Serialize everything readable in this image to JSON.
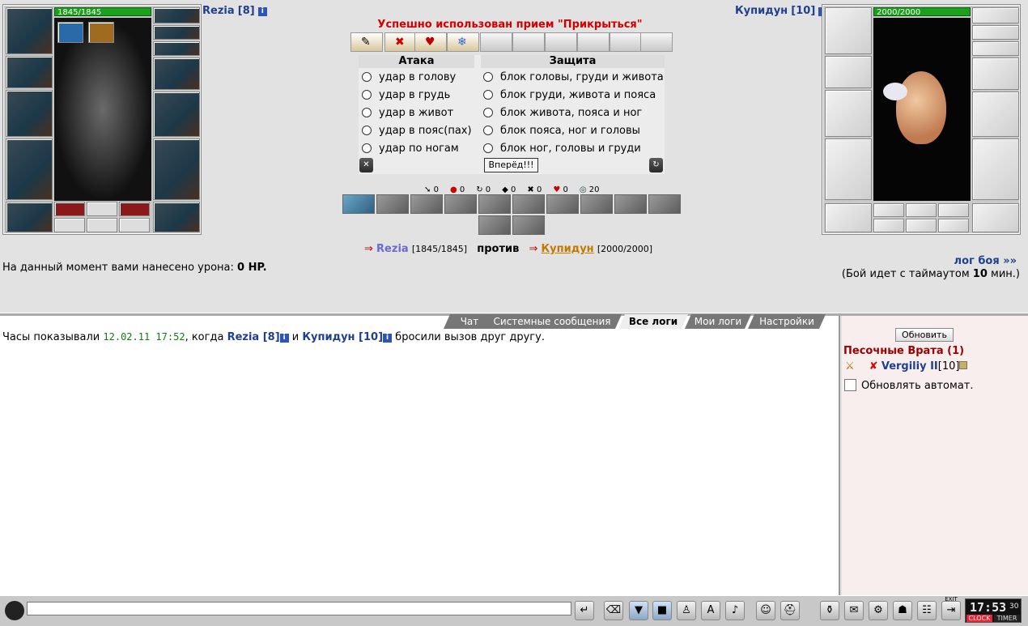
{
  "player": {
    "name": "Rezia",
    "level": "[8]",
    "hp": "1845/1845",
    "hp_fraction": 1.0
  },
  "opponent": {
    "name": "Купидун",
    "level": "[10]",
    "hp": "2000/2000",
    "hp_fraction": 1.0
  },
  "status_message": "Успешно использован прием \"Прикрыться\"",
  "attack": {
    "title": "Атака",
    "options": [
      "удар в голову",
      "удар в грудь",
      "удар в живот",
      "удар в пояс(пах)",
      "удар по ногам"
    ]
  },
  "defense": {
    "title": "Защита",
    "options": [
      "блок головы, груди и живота",
      "блок груди, живота и пояса",
      "блок живота, пояса и ног",
      "блок пояса, ног и головы",
      "блок ног, головы и груди"
    ]
  },
  "forward_button": "Вперёд!!!",
  "stats": [
    "0",
    "0",
    "0",
    "0",
    "0",
    "0",
    "20"
  ],
  "versus": {
    "p1": "Rezia",
    "p1_hp": "[1845/1845]",
    "vs": "против",
    "p2": "Купидун",
    "p2_hp": "[2000/2000]"
  },
  "damage": {
    "prefix": "На данный момент вами нанесено урона:",
    "value": "0 HP."
  },
  "battle_log_link": "лог боя »»",
  "timeout": {
    "prefix": "(Бой идет с таймаутом",
    "value": "10",
    "suffix": "мин.)"
  },
  "tabs": [
    "Чат",
    "Системные сообщения",
    "Все логи",
    "Мои логи",
    "Настройки"
  ],
  "log": {
    "prefix": "Часы показывали",
    "time": "12.02.11 17:52",
    "mid": ", когда",
    "p1": "Rezia [8]",
    "and": "и",
    "p2": "Купидун [10]",
    "suffix": "бросили вызов друг другу."
  },
  "right": {
    "refresh": "Обновить",
    "location": "Песочные Врата (1)",
    "user": "Vergiliy II",
    "user_level": "[10]",
    "auto": "Обновлять автомат."
  },
  "clock": {
    "time": "17:53",
    "seconds": "30",
    "clock_label": "CLOCK",
    "timer_label": "TIMER",
    "exit": "EXIT"
  },
  "colors": {
    "title_blue": "#1f3f8f",
    "status_red": "#d40000",
    "hp_green": "#1aa01a",
    "link_orange": "#c47a00",
    "location_red": "#a00000"
  }
}
